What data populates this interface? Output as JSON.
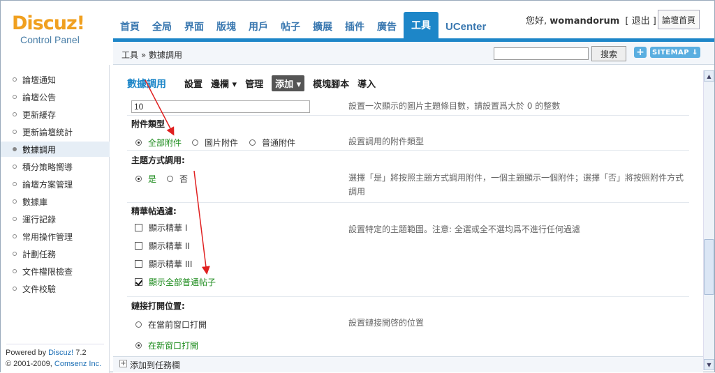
{
  "header": {
    "logo_brand": "Discuz!",
    "logo_sub": "Control Panel",
    "nav": [
      "首頁",
      "全局",
      "界面",
      "版塊",
      "用戶",
      "帖子",
      "擴展",
      "插件",
      "廣告",
      "工具",
      "UCenter"
    ],
    "active_nav": "工具",
    "greeting": "您好,",
    "username": "womandorum",
    "logout": "[ 退出 ]",
    "home_button": "論壇首頁"
  },
  "crumbbar": {
    "breadcrumb": "工具 » 數據調用",
    "search_value": "",
    "search_button": "搜索",
    "plus": "+",
    "sitemap": "SITEMAP ⇓"
  },
  "sidebar": {
    "items": [
      "論壇通知",
      "論壇公告",
      "更新緩存",
      "更新論壇統計",
      "數據調用",
      "積分策略嚮導",
      "論壇方案管理",
      "數據庫",
      "運行記錄",
      "常用操作管理",
      "計劃任務",
      "文件權限檢查",
      "文件校驗"
    ],
    "active": "數據調用",
    "powered_by_prefix": "Powered by ",
    "powered_by_link": "Discuz!",
    "powered_by_version": " 7.2",
    "copyright_prefix": "© 2001-2009, ",
    "copyright_link": "Comsenz Inc."
  },
  "subtabs": {
    "current": "數據調用",
    "items": [
      "設置",
      "邊欄 ▾",
      "管理",
      "添加 ▾",
      "模塊腳本",
      "導入"
    ]
  },
  "form": {
    "count_value": "10",
    "count_desc": "設置一次顯示的圖片主題條目數，請設置爲大於 0 的整數",
    "attach_type_label": "附件類型",
    "attach_type_options": [
      "全部附件",
      "圖片附件",
      "普通附件"
    ],
    "attach_type_desc": "設置調用的附件類型",
    "thread_mode_label": "主題方式調用:",
    "thread_mode_options": [
      "是",
      "否"
    ],
    "thread_mode_desc_1": "選擇「是」將按照主題方式調用附件，一個主題顯示一個附件；選擇「否」將按照附件方式",
    "thread_mode_desc_2": "調用",
    "digest_label": "精華帖過濾:",
    "digest_options": [
      "顯示精華 I",
      "顯示精華 II",
      "顯示精華 III",
      "顯示全部普通帖子"
    ],
    "digest_desc": "設置特定的主題範圍。注意: 全選或全不選均爲不進行任何過濾",
    "link_label": "鏈接打開位置:",
    "link_options": [
      "在當前窗口打開",
      "在新窗口打開"
    ],
    "link_desc": "設置鏈接開啓的位置"
  },
  "bottombar": {
    "plus": "+",
    "label": "添加到任務欄"
  },
  "colors": {
    "accent": "#1d86c8",
    "selected_text": "#1a8a1a",
    "annotation_arrow": "#e02020"
  }
}
